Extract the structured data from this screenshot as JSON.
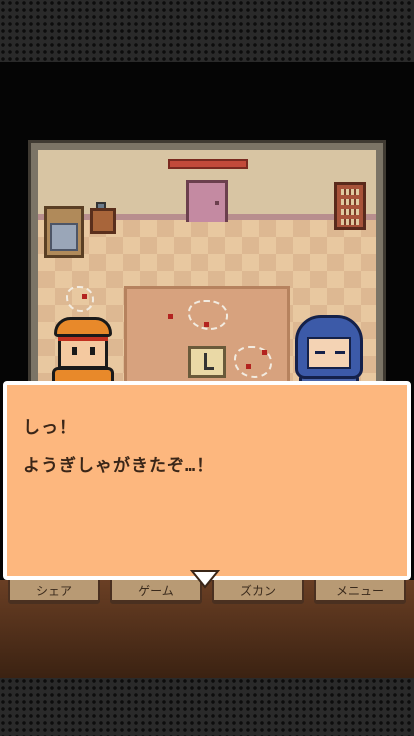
{
  "dialog": {
    "line1": "しっ！",
    "line2": "ようぎしゃがきたぞ…！"
  },
  "menu": {
    "items": [
      {
        "label": "シェア"
      },
      {
        "label": "ゲーム"
      },
      {
        "label": "ズカン"
      },
      {
        "label": "メニュー"
      }
    ]
  },
  "colors": {
    "dialog_bg": "#fdb77e",
    "dialog_border": "#ffffff",
    "dialog_text": "#3a2618",
    "menu_button": "#b89a74",
    "room_floor": "#e8c8a0",
    "orange_character": "#e8892a",
    "blue_character": "#3c5aa8"
  },
  "icons": {
    "next": "triangle-down-icon"
  }
}
